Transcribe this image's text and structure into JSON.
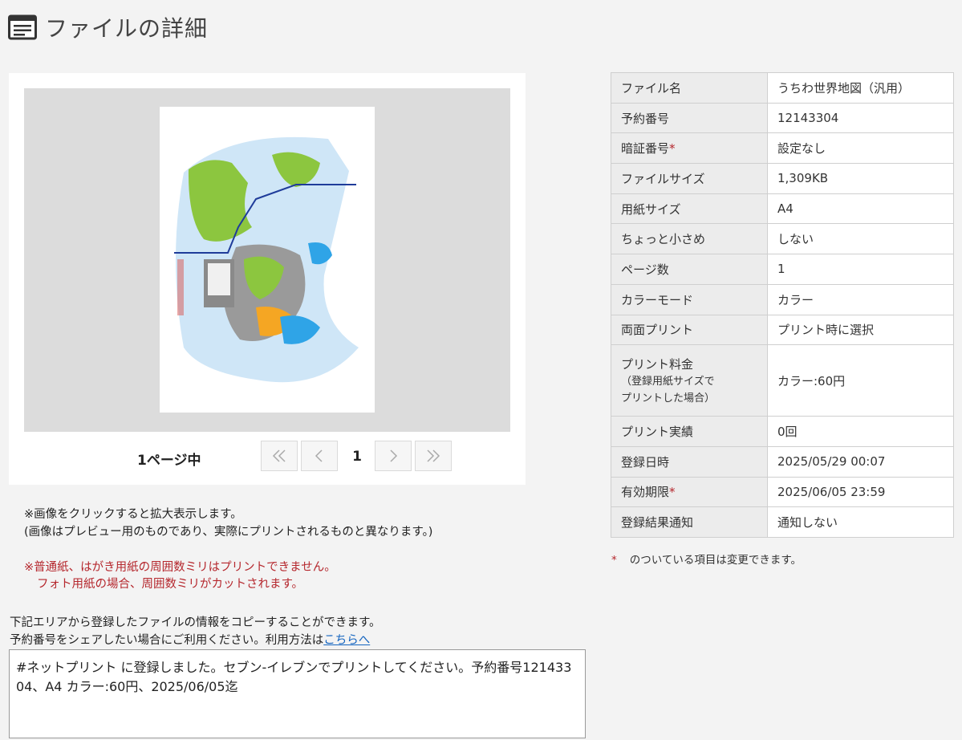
{
  "page": {
    "title": "ファイルの詳細",
    "icon": "document-list-icon"
  },
  "preview": {
    "page_of_label": "1ページ中",
    "current_page": "1",
    "buttons": [
      "first-page-icon",
      "prev-page-icon",
      "next-page-icon",
      "last-page-icon"
    ]
  },
  "notes": {
    "line1": "※画像をクリックすると拡大表示します。",
    "line2": "(画像はプレビュー用のものであり、実際にプリントされるものと異なります。)"
  },
  "warning": {
    "line1": "※普通紙、はがき用紙の周囲数ミリはプリントできません。",
    "line2": "フォト用紙の場合、周囲数ミリがカットされます。"
  },
  "share": {
    "line1": "下記エリアから登録したファイルの情報をコピーすることができます。",
    "line2_prefix": "予約番号をシェアしたい場合にご利用ください。利用方法は",
    "link_text": "こちらへ",
    "text": "#ネットプリント に登録しました。セブン-イレブンでプリントしてください。予約番号12143304、A4 カラー:60円、2025/06/05迄"
  },
  "details": {
    "file_name": {
      "label": "ファイル名",
      "value": "うちわ世界地図（汎用）"
    },
    "reservation_no": {
      "label": "予約番号",
      "value": "12143304"
    },
    "pin": {
      "label": "暗証番号",
      "value": "設定なし"
    },
    "file_size": {
      "label": "ファイルサイズ",
      "value": "1,309KB"
    },
    "paper_size": {
      "label": "用紙サイズ",
      "value": "A4"
    },
    "slightly_smaller": {
      "label": "ちょっと小さめ",
      "value": "しない"
    },
    "page_count": {
      "label": "ページ数",
      "value": "1"
    },
    "color_mode": {
      "label": "カラーモード",
      "value": "カラー"
    },
    "duplex": {
      "label": "両面プリント",
      "value": "プリント時に選択"
    },
    "price": {
      "label": "プリント料金",
      "sub1": "（登録用紙サイズで",
      "sub2": "プリントした場合）",
      "value": "カラー:60円"
    },
    "print_count": {
      "label": "プリント実績",
      "value": "0回"
    },
    "registered_at": {
      "label": "登録日時",
      "value": "2025/05/29 00:07"
    },
    "expires_at": {
      "label": "有効期限",
      "value": "2025/06/05 23:59"
    },
    "notify": {
      "label": "登録結果通知",
      "value": "通知しない"
    }
  },
  "required_mark": "*",
  "footnote": "のついている項目は変更できます。",
  "colors": {
    "warning": "#b5272d",
    "link": "#1565c0",
    "land": "#8cc63f",
    "ocean": "#cfe6f7"
  }
}
